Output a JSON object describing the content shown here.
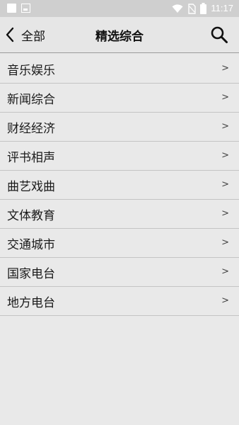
{
  "status_bar": {
    "time": "11:17"
  },
  "header": {
    "back_label": "全部",
    "title": "精选综合"
  },
  "list": {
    "chevron": ">",
    "items": [
      {
        "label": "音乐娱乐"
      },
      {
        "label": "新闻综合"
      },
      {
        "label": "财经经济"
      },
      {
        "label": "评书相声"
      },
      {
        "label": "曲艺戏曲"
      },
      {
        "label": "文体教育"
      },
      {
        "label": "交通城市"
      },
      {
        "label": "国家电台"
      },
      {
        "label": "地方电台"
      }
    ]
  },
  "icons": {
    "back": "chevron-left-icon",
    "search": "search-icon",
    "wifi": "wifi-icon",
    "battery": "battery-icon",
    "sim": "no-sim-icon"
  },
  "colors": {
    "background": "#e9e9e9",
    "status_bar": "#cfcfcf",
    "divider": "#c4c4c4"
  }
}
